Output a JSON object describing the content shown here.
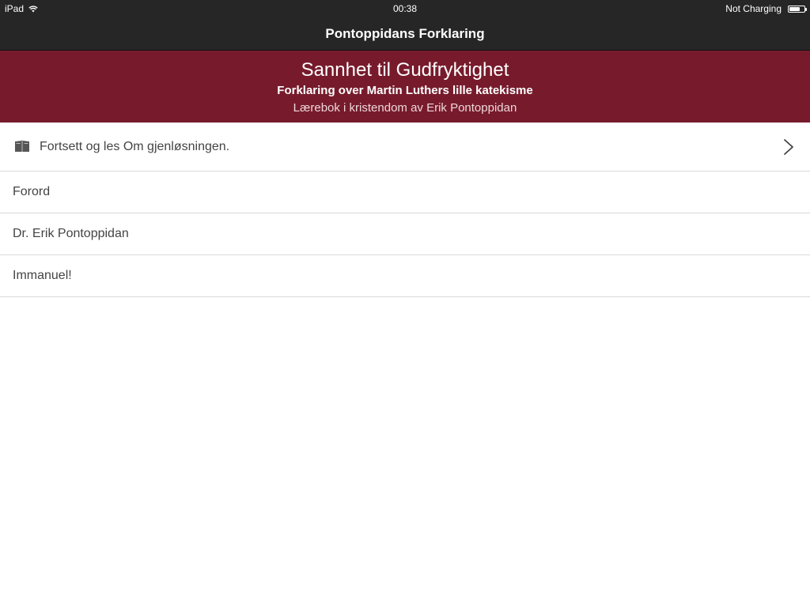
{
  "status": {
    "device": "iPad",
    "time": "00:38",
    "battery_text": "Not Charging",
    "battery_level": 0.7
  },
  "nav": {
    "title": "Pontoppidans Forklaring"
  },
  "banner": {
    "title": "Sannhet til Gudfryktighet",
    "subtitle": "Forklaring over Martin Luthers lille katekisme",
    "author": "Lærebok i kristendom av Erik Pontoppidan",
    "color": "#771b2c"
  },
  "continue": {
    "label": "Fortsett og les Om gjenløsningen.",
    "icon": "book-icon",
    "disclosure_icon": "chevron-right-icon"
  },
  "items": [
    {
      "label": "Forord"
    },
    {
      "label": "Dr. Erik Pontoppidan"
    },
    {
      "label": "Immanuel!"
    }
  ]
}
